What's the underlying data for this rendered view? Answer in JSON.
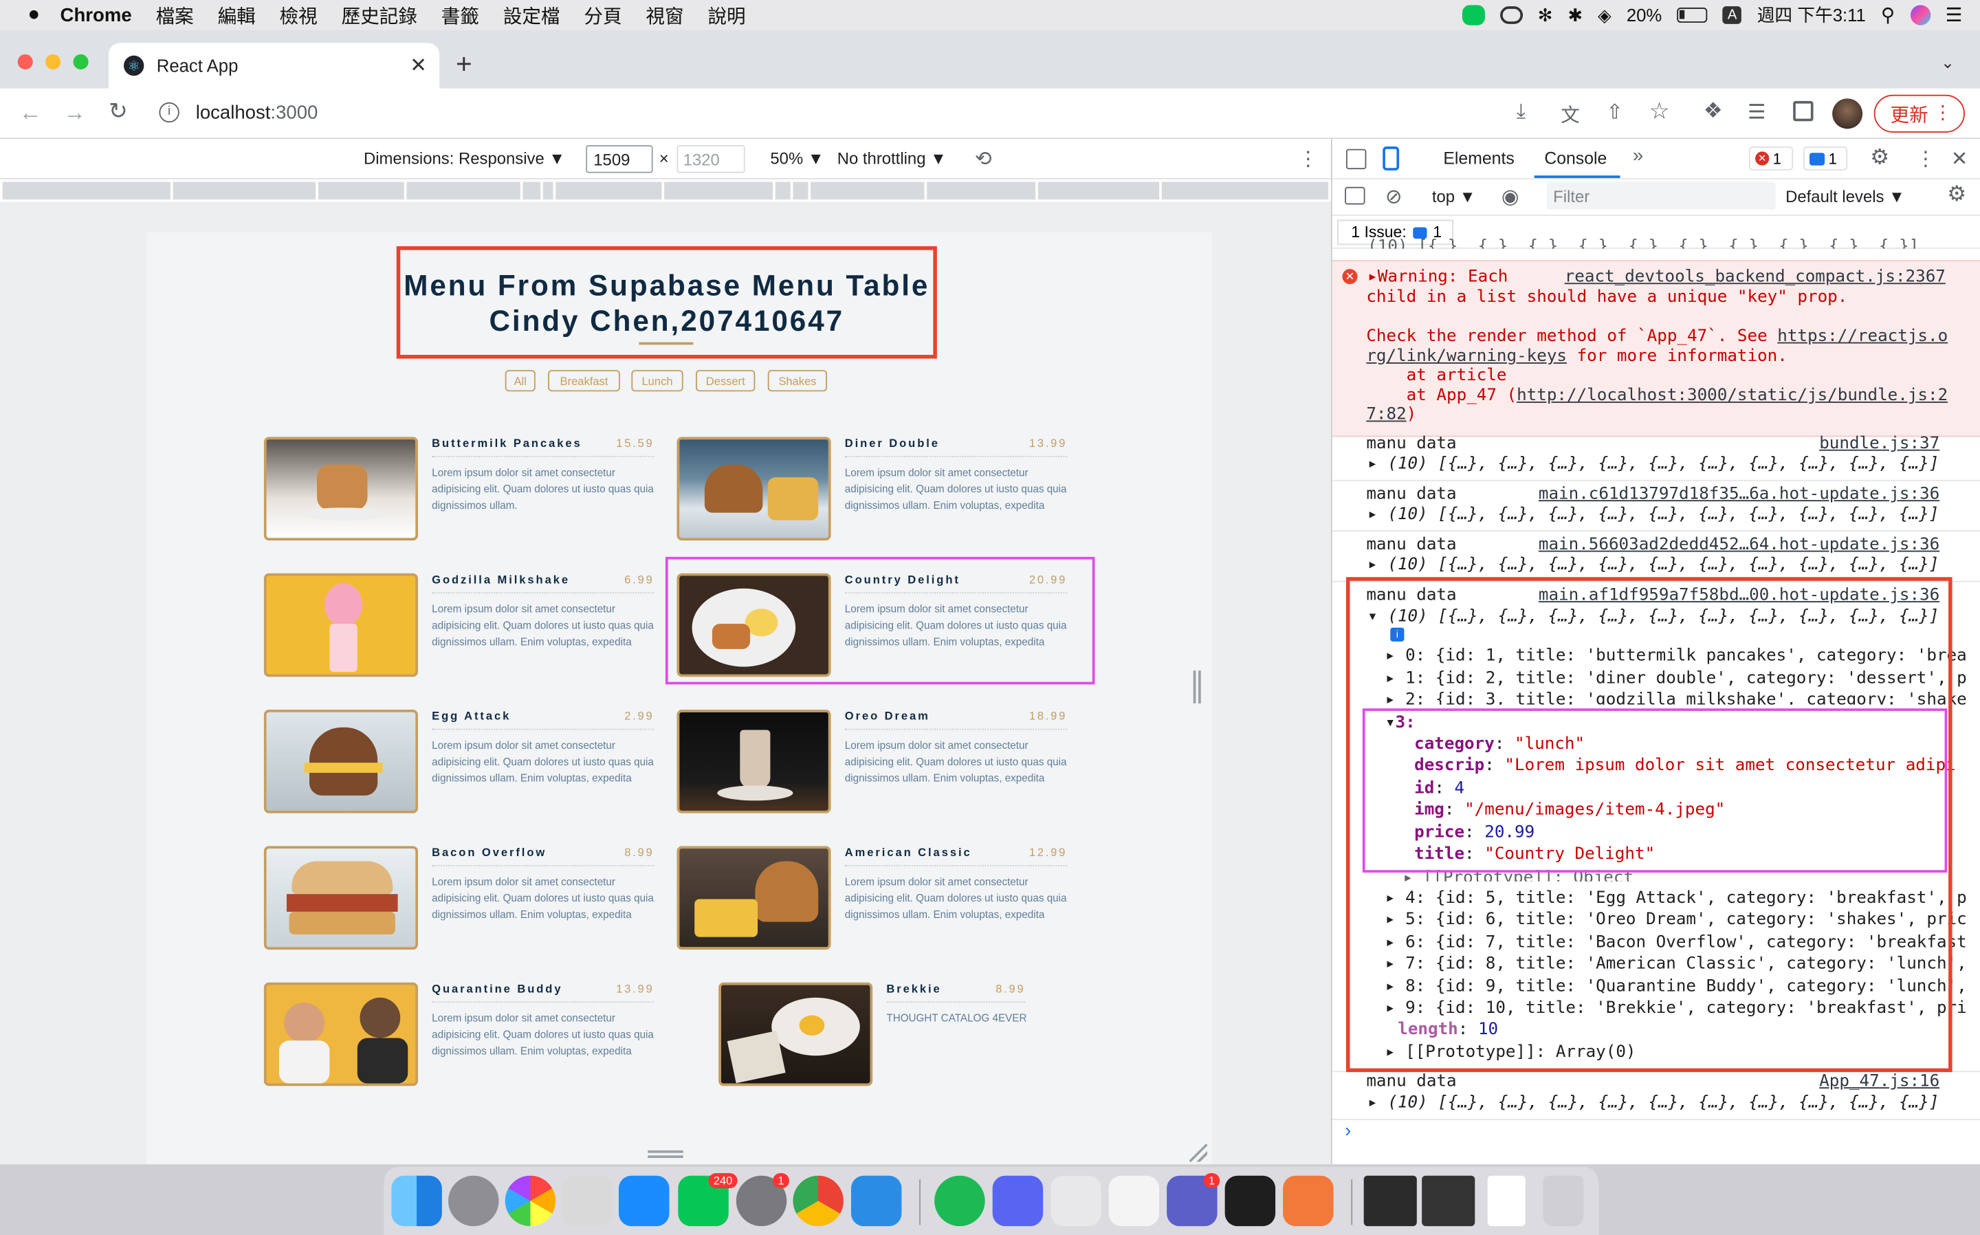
{
  "menubar": {
    "app": "Chrome",
    "items": [
      "檔案",
      "編輯",
      "檢視",
      "歷史記錄",
      "書籤",
      "設定檔",
      "分頁",
      "視窗",
      "說明"
    ],
    "battery": "20%",
    "input_badge": "A",
    "clock": "週四 下午3:11"
  },
  "browser": {
    "tab_title": "React App",
    "address_host": "localhost",
    "address_port": ":3000",
    "update_label": "更新"
  },
  "device_toolbar": {
    "dimensions_label": "Dimensions: Responsive",
    "width": "1509",
    "height": "1320",
    "zoom": "50%",
    "throttling": "No throttling"
  },
  "page": {
    "title_line1": "Menu From Supabase Menu Table",
    "title_line2": "Cindy Chen,207410647",
    "categories": [
      "All",
      "Breakfast",
      "Lunch",
      "Dessert",
      "Shakes"
    ],
    "lorem": "Lorem ipsum dolor sit amet consectetur adipisicing elit. Quam dolores ut iusto quas quia dignissimos ullam.",
    "lorem_long": "Lorem ipsum dolor sit amet consectetur adipisicing elit. Quam dolores ut iusto quas quia dignissimos ullam. Enim voluptas, expedita",
    "items": [
      {
        "title": "Buttermilk Pancakes",
        "price": "15.59"
      },
      {
        "title": "Diner Double",
        "price": "13.99"
      },
      {
        "title": "Godzilla Milkshake",
        "price": "6.99"
      },
      {
        "title": "Country Delight",
        "price": "20.99"
      },
      {
        "title": "Egg Attack",
        "price": "2.99"
      },
      {
        "title": "Oreo Dream",
        "price": "18.99"
      },
      {
        "title": "Bacon Overflow",
        "price": "8.99"
      },
      {
        "title": "American Classic",
        "price": "12.99"
      },
      {
        "title": "Quarantine Buddy",
        "price": "13.99"
      },
      {
        "title": "Brekkie",
        "price": "8.99",
        "desc": "THOUGHT CATALOG 4EVER"
      }
    ]
  },
  "devtools": {
    "tabs": [
      "Elements",
      "Console"
    ],
    "error_count": "1",
    "message_count": "1",
    "context": "top",
    "filter_placeholder": "Filter",
    "levels": "Default levels",
    "issues": "1 Issue:",
    "issues_count": "1",
    "warning": {
      "line1": "Warning: Each",
      "source": "react_devtools_backend_compact.js:2367",
      "line2": "child in a list should have a unique \"key\" prop.",
      "line3_a": "Check the render method of `App_47`. See ",
      "line3_link": "https://reactjs.o",
      "line4_link": "rg/link/warning-keys",
      "line4_b": " for more information.",
      "line5": "    at article",
      "line6_a": "    at App_47 (",
      "line6_link": "http://localhost:3000/static/js/bundle.js:2",
      "line7_link": "7:82",
      "line7_b": ")"
    },
    "logs": [
      {
        "label": "manu data",
        "source": "bundle.js:37"
      },
      {
        "label": "manu data",
        "source": "main.c61d13797d18f35…6a.hot-update.js:36"
      },
      {
        "label": "manu data",
        "source": "main.56603ad2dedd452…64.hot-update.js:36"
      },
      {
        "label": "manu data",
        "source": "main.af1df959a7f58bd…00.hot-update.js:36"
      },
      {
        "label": "manu data",
        "source": "App_47.js:16"
      }
    ],
    "array_summary": "(10) [{…}, {…}, {…}, {…}, {…}, {…}, {…}, {…}, {…}, {…}]",
    "rows_top": [
      "0: {id: 1, title: 'buttermilk pancakes', category: 'brea",
      "1: {id: 2, title: 'diner double', category: 'dessert', p",
      "2: {id: 3, title: 'godzilla milkshake', category: 'shake"
    ],
    "expanded": {
      "key": "3:",
      "category": "\"lunch\"",
      "descrip": "\"Lorem ipsum dolor sit amet consectetur adipi",
      "id": "4",
      "img": "\"/menu/images/item-4.jpeg\"",
      "price": "20.99",
      "title": "\"Country Delight\""
    },
    "proto_object": "[[Prototype]]: Object",
    "rows_bottom": [
      "4: {id: 5, title: 'Egg Attack', category: 'breakfast', p",
      "5: {id: 6, title: 'Oreo Dream', category: 'shakes', pric",
      "6: {id: 7, title: 'Bacon Overflow', category: 'breakfast",
      "7: {id: 8, title: 'American Classic', category: 'lunch',",
      "8: {id: 9, title: 'Quarantine Buddy', category: 'lunch',",
      "9: {id: 10, title: 'Brekkie', category: 'breakfast', pri"
    ],
    "length_key": "length",
    "length_val": "10",
    "proto_array": "[[Prototype]]: Array(0)",
    "top_clipped": "(10) [{…}, {…}, {…}, {…}, {…}, {…}, {…}, {…}, {…}, {…}]"
  },
  "dock": {
    "line_badge": "240",
    "prefs_badge": "1",
    "teams_badge": "1"
  },
  "colors": {
    "accent_gold": "#c59d5f",
    "heading_navy": "#102a42",
    "annotation_red": "#e8422e",
    "annotation_magenta": "#e04be8",
    "chrome_blue": "#1a73e8"
  }
}
